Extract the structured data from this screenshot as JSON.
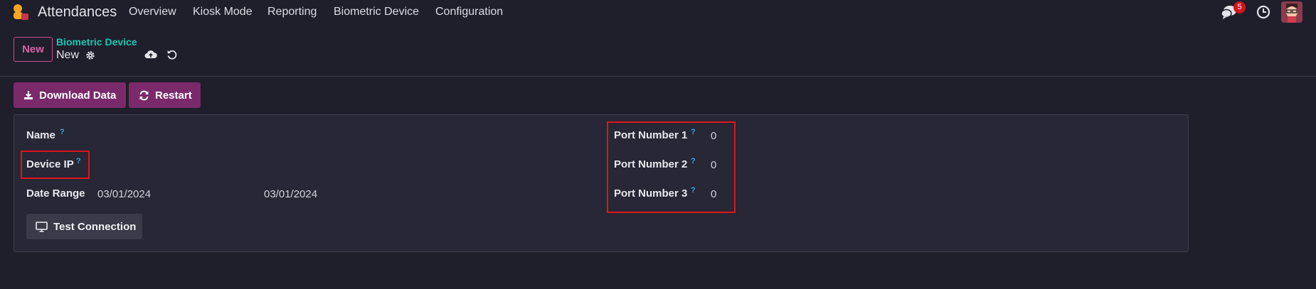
{
  "navbar": {
    "app_name": "Attendances",
    "menu": [
      "Overview",
      "Kiosk Mode",
      "Reporting",
      "Biometric Device",
      "Configuration"
    ],
    "chat_count": "5",
    "icons": [
      "app-logo-icon",
      "chat-icon",
      "clock-icon",
      "user-avatar"
    ]
  },
  "control_panel": {
    "new_label": "New",
    "breadcrumb_parent": "Biometric Device",
    "breadcrumb_current": "New"
  },
  "actions": {
    "download_label": "Download Data",
    "restart_label": "Restart"
  },
  "form": {
    "name_label": "Name",
    "device_ip_label": "Device IP",
    "date_range_label": "Date Range",
    "date_from": "03/01/2024",
    "date_to": "03/01/2024",
    "help_mark": "?",
    "test_connection_label": "Test Connection",
    "ports": [
      {
        "label": "Port Number 1",
        "value": "0"
      },
      {
        "label": "Port Number 2",
        "value": "0"
      },
      {
        "label": "Port Number 3",
        "value": "0"
      }
    ]
  },
  "colors": {
    "background": "#1f1e2b",
    "primary_button": "#7a2a6b",
    "breadcrumb_link": "#17c8b3",
    "help_mark": "#35a7e0",
    "annotation": "#e0151c"
  }
}
